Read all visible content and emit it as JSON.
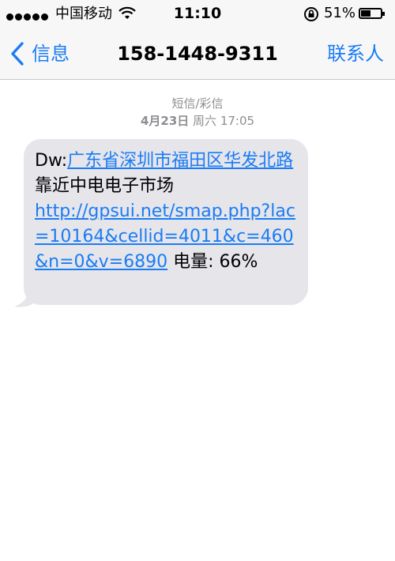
{
  "status_bar": {
    "carrier": "中国移动",
    "time": "11:10",
    "battery_percent": "51%",
    "battery_level": 0.51,
    "icons": [
      "signal-dots-icon",
      "wifi-icon",
      "rotation-lock-icon",
      "battery-icon"
    ]
  },
  "nav": {
    "back_label": "信息",
    "title": "158-1448-9311",
    "contact_label": "联系人"
  },
  "thread": {
    "message_type": "短信/彩信",
    "date_bold": "4月23日",
    "date_rest": "周六 17:05"
  },
  "message": {
    "prefix": "Dw:",
    "address_link": "广东省深圳市福田区华发北路",
    "location_text": "靠近中电电子市场",
    "url": "http://gpsui.net/smap.php?lac=10164&cellid=4011&c=460&n=0&v=6890",
    "battery_text": " 电量: 66%"
  },
  "colors": {
    "accent": "#1a7cf5",
    "bubble": "#e5e5ea",
    "meta": "#8e8e93"
  }
}
